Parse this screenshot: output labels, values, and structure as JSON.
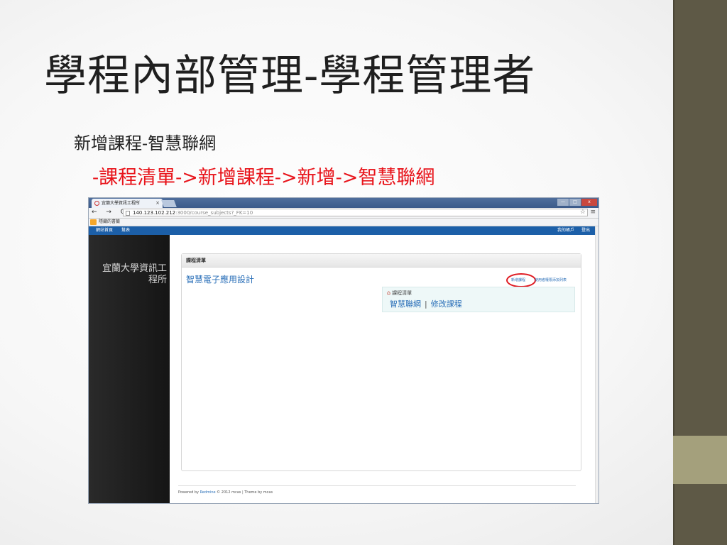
{
  "slide": {
    "title": "學程內部管理-學程管理者",
    "subtitle": "新增課程-智慧聯網",
    "path": "-課程清單->新增課程->新增->智慧聯網"
  },
  "browser": {
    "tab_title": "宜蘭大學資訊工程所",
    "tab_close": "×",
    "nav": "← → C",
    "url_host": "140.123.102.212",
    "url_rest": ":3000/course_subjects?_FK=10",
    "bookmarks_label": "隱藏的書籤",
    "win_min": "—",
    "win_max": "□",
    "win_close": "x"
  },
  "app": {
    "menu_home": "網站首頁",
    "menu_help": "幫表",
    "menu_account": "我的帳戶",
    "menu_logout": "登出",
    "org_name": "宜蘭大學資訊工程所",
    "panel_title": "課程清單",
    "course_name": "智慧電子應用設計",
    "btn_new_course": "新增課程",
    "btn_import": "使用者權限添加列表",
    "dropdown_header": "課程清單",
    "dropdown_link1": "智慧聯網",
    "dropdown_sep": "|",
    "dropdown_link2": "修改課程",
    "footer_prefix": "Powered by ",
    "footer_link": "Redmine",
    "footer_suffix": " © 2012 mcas | Theme by mcas"
  },
  "colors": {
    "accent_bar": "#5e5946",
    "accent_block": "#a4a07c",
    "path_red": "#e8141b",
    "app_bar_blue": "#1c5fa8"
  }
}
